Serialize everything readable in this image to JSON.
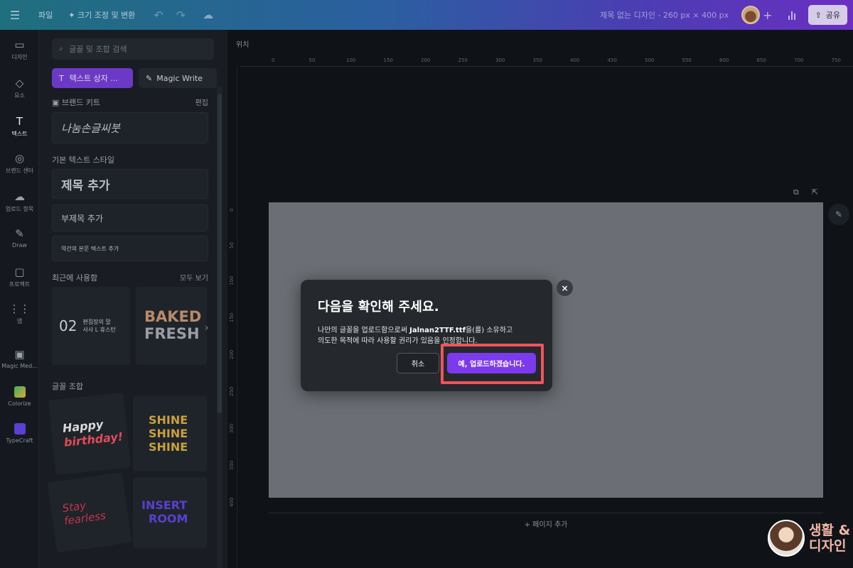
{
  "topbar": {
    "file_label": "파일",
    "resize_label": "크기 조정 및 변환",
    "design_title": "제목 없는 디자인 - 260 px × 400 px",
    "share_label": "공유"
  },
  "rail": [
    {
      "label": "디자인",
      "icon": "layout-icon"
    },
    {
      "label": "요소",
      "icon": "shapes-icon"
    },
    {
      "label": "텍스트",
      "icon": "text-icon"
    },
    {
      "label": "브랜드 센터",
      "icon": "brand-icon"
    },
    {
      "label": "업로드 항목",
      "icon": "upload-icon"
    },
    {
      "label": "Draw",
      "icon": "draw-icon"
    },
    {
      "label": "프로젝트",
      "icon": "folder-icon"
    },
    {
      "label": "앱",
      "icon": "apps-icon"
    },
    {
      "label": "Magic Med...",
      "icon": "magic-media-icon"
    },
    {
      "label": "Colorize",
      "icon": "colorize-icon"
    },
    {
      "label": "TypeCraft",
      "icon": "typecraft-icon"
    }
  ],
  "panel": {
    "search_placeholder": "글꼴 및 조합 검색",
    "textbox_button": "텍스트 상자 ...",
    "magic_write_button": "Magic Write",
    "brand_kit_label": "브랜드 키트",
    "brand_kit_edit": "편집",
    "brand_font_sample": "나눔손글씨붓",
    "default_styles_label": "기본 텍스트 스타일",
    "add_heading": "제목 추가",
    "add_subheading": "부제목 추가",
    "add_body": "약간의 본문 텍스트 추가",
    "recent_label": "최근에 사용함",
    "see_all": "모두 보기",
    "recent_item_1_number": "02",
    "recent_item_1_text_line1": "편집장의 말",
    "recent_item_1_text_line2": "사사 L 휴스턴",
    "recent_item_2_line1": "BAKED",
    "recent_item_2_line2": "FRESH",
    "font_combos_label": "글꼴 조합",
    "combo_1_line1": "Happy",
    "combo_1_line2": "birthday!",
    "combo_2": "SHINE",
    "combo_3_line1": "Stay",
    "combo_3_line2": "fearless",
    "combo_4_line1": "INSERT",
    "combo_4_line2": "ROOM"
  },
  "workspace": {
    "position_label": "위치",
    "ruler_ticks": [
      "0",
      "50",
      "100",
      "150",
      "200",
      "250",
      "300",
      "350",
      "400",
      "450",
      "500",
      "550",
      "600",
      "650",
      "700",
      "750"
    ],
    "ruler_v_ticks": [
      "0",
      "50",
      "100",
      "150",
      "200",
      "250",
      "300",
      "350",
      "400"
    ],
    "add_page_label": "+ 페이지 추가"
  },
  "modal": {
    "title": "다음을 확인해 주세요.",
    "body_prefix": "나만의 글꼴을 업로드함으로써 ",
    "body_filename": "Jalnan2TTF.ttf",
    "body_suffix_line1": "을(를) 소유하고",
    "body_line2": "의도한 목적에 따라 사용할 권리가 있음을 인정합니다.",
    "cancel_label": "취소",
    "confirm_label": "예, 업로드하겠습니다.",
    "close_symbol": "×"
  },
  "watermark": {
    "line1": "생활 &",
    "line2": "디자인"
  },
  "colors": {
    "accent": "#7c3aed",
    "highlight": "#f0545c",
    "canvas": "#6b6f75"
  }
}
